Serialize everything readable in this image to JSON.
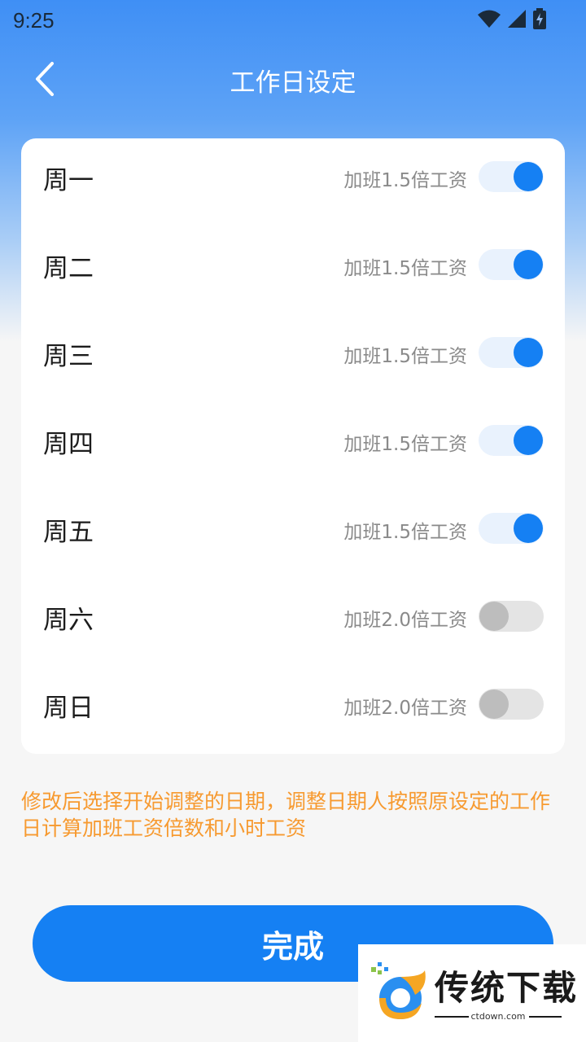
{
  "status_bar": {
    "time": "9:25"
  },
  "header": {
    "title": "工作日设定"
  },
  "days": [
    {
      "label": "周一",
      "overtime": "加班1.5倍工资",
      "enabled": true
    },
    {
      "label": "周二",
      "overtime": "加班1.5倍工资",
      "enabled": true
    },
    {
      "label": "周三",
      "overtime": "加班1.5倍工资",
      "enabled": true
    },
    {
      "label": "周四",
      "overtime": "加班1.5倍工资",
      "enabled": true
    },
    {
      "label": "周五",
      "overtime": "加班1.5倍工资",
      "enabled": true
    },
    {
      "label": "周六",
      "overtime": "加班2.0倍工资",
      "enabled": false
    },
    {
      "label": "周日",
      "overtime": "加班2.0倍工资",
      "enabled": false
    }
  ],
  "note": "修改后选择开始调整的日期，调整日期人按照原设定的工作日计算加班工资倍数和小时工资",
  "done_button": {
    "label": "完成"
  },
  "watermark": {
    "brand": "传统下载",
    "domain": "ctdown.com"
  },
  "colors": {
    "accent": "#1580f3",
    "note": "#f79a30"
  }
}
